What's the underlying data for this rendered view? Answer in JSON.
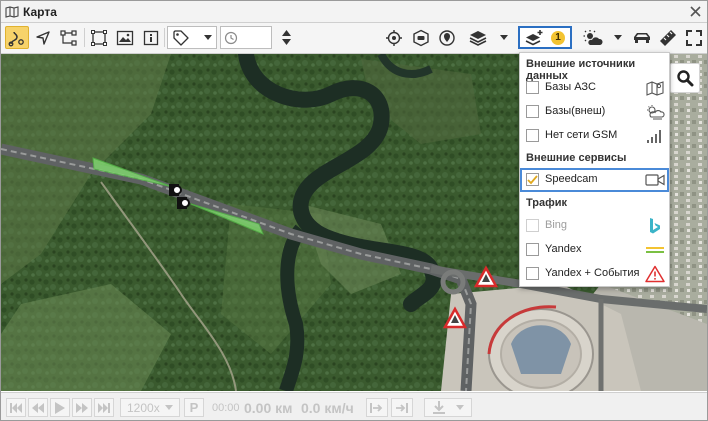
{
  "window": {
    "title": "Карта",
    "icon": "map-icon"
  },
  "toolbar": {
    "buttons": [
      {
        "name": "route-tool",
        "icon": "route-icon",
        "active": true
      },
      {
        "name": "navigate-tool",
        "icon": "navigate-arrow-icon"
      },
      {
        "name": "network-tool",
        "icon": "network-icon"
      },
      {
        "name": "area-select-tool",
        "icon": "area-select-icon"
      },
      {
        "name": "image-tool",
        "icon": "image-icon"
      },
      {
        "name": "info-tool",
        "icon": "info-icon"
      },
      {
        "name": "tag-tool",
        "icon": "tag-icon"
      },
      {
        "name": "locate-button",
        "icon": "locate-icon"
      },
      {
        "name": "geofence-button",
        "icon": "geofence-icon"
      },
      {
        "name": "pin-button",
        "icon": "pin-icon"
      },
      {
        "name": "layers-button",
        "icon": "layers-icon"
      },
      {
        "name": "layers-add-button",
        "icon": "layers-add-icon",
        "badge": "1"
      },
      {
        "name": "weather-button",
        "icon": "weather-icon"
      },
      {
        "name": "vehicle-button",
        "icon": "car-icon"
      },
      {
        "name": "ruler-button",
        "icon": "ruler-icon"
      },
      {
        "name": "fullscreen-button",
        "icon": "fullscreen-icon"
      }
    ],
    "time_value": ""
  },
  "layers_panel": {
    "sections": [
      {
        "title": "Внешние источники данных",
        "items": [
          {
            "label": "Базы АЗС",
            "checked": false,
            "disabled": false,
            "icon": "map-fold-icon"
          },
          {
            "label": "Базы(внеш)",
            "checked": false,
            "disabled": false,
            "icon": "weather-cloud-icon"
          },
          {
            "label": "Нет сети GSM",
            "checked": false,
            "disabled": false,
            "icon": "signal-bars-icon"
          }
        ]
      },
      {
        "title": "Внешние сервисы",
        "items": [
          {
            "label": "Speedcam",
            "checked": true,
            "disabled": false,
            "selected": true,
            "icon": "video-camera-icon"
          }
        ]
      },
      {
        "title": "Трафик",
        "items": [
          {
            "label": "Bing",
            "checked": false,
            "disabled": true,
            "icon": "bing-logo-icon"
          },
          {
            "label": "Yandex",
            "checked": false,
            "disabled": false,
            "icon": "traffic-lines-icon"
          },
          {
            "label": "Yandex + События",
            "checked": false,
            "disabled": false,
            "icon": "warning-triangle-icon"
          }
        ]
      }
    ]
  },
  "player": {
    "speed": "1200x",
    "p_label": "P",
    "time": "00:00",
    "distance": "0.00 км",
    "velocity": "0.0 км/ч"
  },
  "colors": {
    "accent": "#f7d36a",
    "selection": "#2b6fc2",
    "warning": "#e03030"
  }
}
